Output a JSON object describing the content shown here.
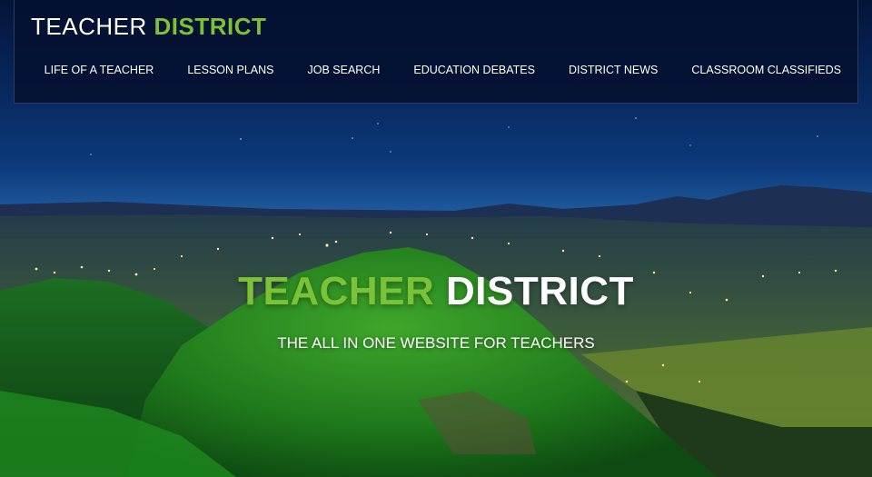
{
  "brand": {
    "word1": "TEACHER",
    "word2": "DISTRICT"
  },
  "nav": [
    {
      "label": "LIFE OF A TEACHER"
    },
    {
      "label": "LESSON PLANS"
    },
    {
      "label": "JOB SEARCH"
    },
    {
      "label": "EDUCATION DEBATES"
    },
    {
      "label": "DISTRICT NEWS"
    },
    {
      "label": "CLASSROOM CLASSIFIEDS"
    }
  ],
  "hero": {
    "title_word1": "TEACHER",
    "title_word2": "DISTRICT",
    "tagline": "THE ALL IN ONE WEBSITE FOR TEACHERS"
  },
  "colors": {
    "accent": "#7cc237",
    "header_bg": "#04102f",
    "sky": "#0b2f6b"
  }
}
